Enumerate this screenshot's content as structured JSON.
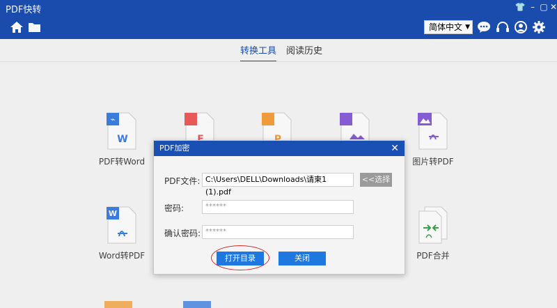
{
  "titlebar": {
    "title": "PDF快转"
  },
  "toolbar": {
    "language": "简体中文"
  },
  "tabs": [
    {
      "label": "转换工具"
    },
    {
      "label": "阅读历史"
    }
  ],
  "tools": [
    {
      "label": "PDF转Word",
      "badge": "W"
    },
    {
      "label": "",
      "badge": "E"
    },
    {
      "label": "",
      "badge": "P"
    },
    {
      "label": "",
      "badge": ""
    },
    {
      "label": "图片转PDF",
      "badge": ""
    },
    {
      "label": "Word转PDF",
      "badge": "W"
    },
    {
      "label": "PDF合并",
      "badge": ""
    }
  ],
  "dialog": {
    "title": "PDF加密",
    "file_label": "PDF文件:",
    "file_value": "C:\\Users\\DELL\\Downloads\\请柬1 (1).pdf",
    "choose_label": "<<选择",
    "password_label": "密码:",
    "password_value": "******",
    "confirm_label": "确认密码:",
    "confirm_value": "******",
    "open_dir_label": "打开目录",
    "close_label": "关闭"
  },
  "colors": {
    "brand": "#1a4fb3",
    "button": "#1e78e0",
    "highlight": "#d62828"
  }
}
